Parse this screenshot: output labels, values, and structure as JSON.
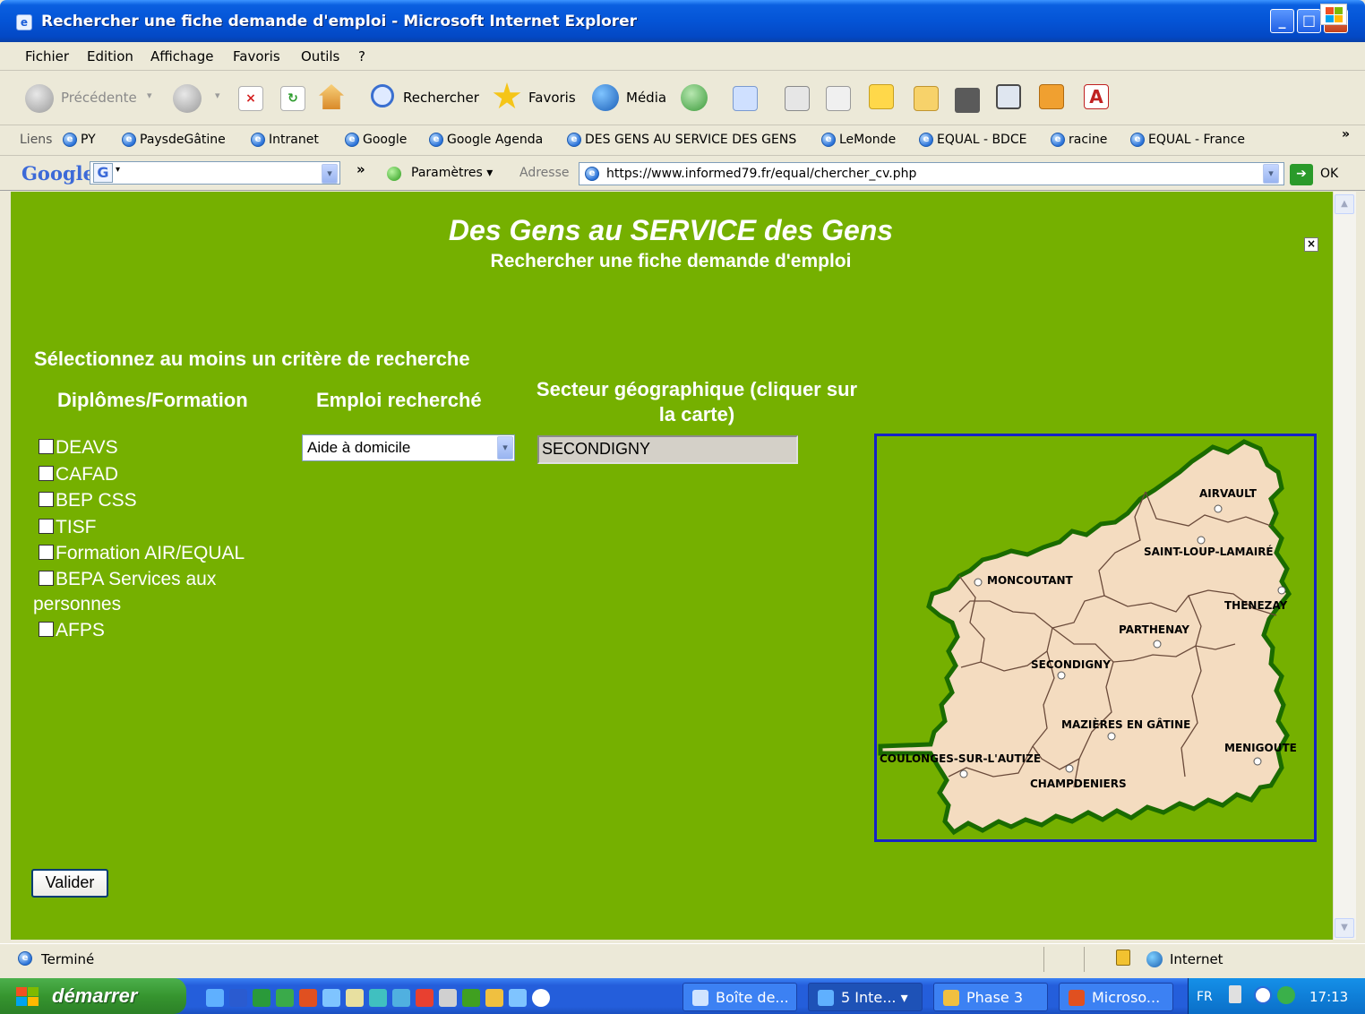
{
  "window": {
    "title": "Rechercher une fiche demande d'emploi - Microsoft Internet Explorer"
  },
  "menu": [
    "Fichier",
    "Edition",
    "Affichage",
    "Favoris",
    "Outils",
    "?"
  ],
  "toolbar": {
    "back": "Précédente",
    "search": "Rechercher",
    "favorites": "Favoris",
    "media": "Média"
  },
  "links": {
    "label": "Liens",
    "items": [
      "PY",
      "PaysdeGâtine",
      "Intranet",
      "Google",
      "Google Agenda",
      "DES GENS AU SERVICE DES GENS",
      "LeMonde",
      "EQUAL - BDCE",
      "racine",
      "EQUAL - France"
    ],
    "more": "»"
  },
  "google_bar": {
    "logo": "Google",
    "g_button": "G",
    "params": "Paramètres",
    "more": "»"
  },
  "address": {
    "label": "Adresse",
    "url": "https://www.informed79.fr/equal/chercher_cv.php",
    "go": "OK"
  },
  "page": {
    "site_title": "Des Gens au SERVICE des Gens",
    "page_title": "Rechercher une fiche demande d'emploi",
    "close": "×",
    "instruction": "Sélectionnez au moins un critère de recherche",
    "col_diplomas": "Diplômes/Formation",
    "col_job": "Emploi recherché",
    "col_geo": "Secteur géographique (cliquer sur la carte)",
    "diplomas": [
      "DEAVS",
      "CAFAD",
      "BEP CSS",
      "TISF",
      "Formation AIR/EQUAL",
      "BEPA Services aux personnes",
      "AFPS"
    ],
    "job_selected": "Aide à domicile",
    "geo_value": "SECONDIGNY",
    "submit": "Valider"
  },
  "map": {
    "towns": [
      "AIRVAULT",
      "SAINT-LOUP-LAMAIRÉ",
      "MONCOUTANT",
      "THENEZAY",
      "PARTHENAY",
      "SECONDIGNY",
      "MAZIÈRES EN GÂTINE",
      "MENIGOUTE",
      "COULONGES-SUR-L'AUTIZE",
      "CHAMPDENIERS"
    ],
    "colors": {
      "land": "#f4dcc0",
      "border": "#1a6b00",
      "frame": "#1522c8"
    }
  },
  "status": {
    "text": "Terminé",
    "zone": "Internet"
  },
  "taskbar": {
    "start": "démarrer",
    "tasks": [
      "Boîte de...",
      "5 Inte...",
      "Phase 3",
      "Microso..."
    ],
    "lang": "FR",
    "clock": "17:13"
  },
  "colors": {
    "page_bg": "#75b000",
    "title_bar": "#0454d6"
  }
}
